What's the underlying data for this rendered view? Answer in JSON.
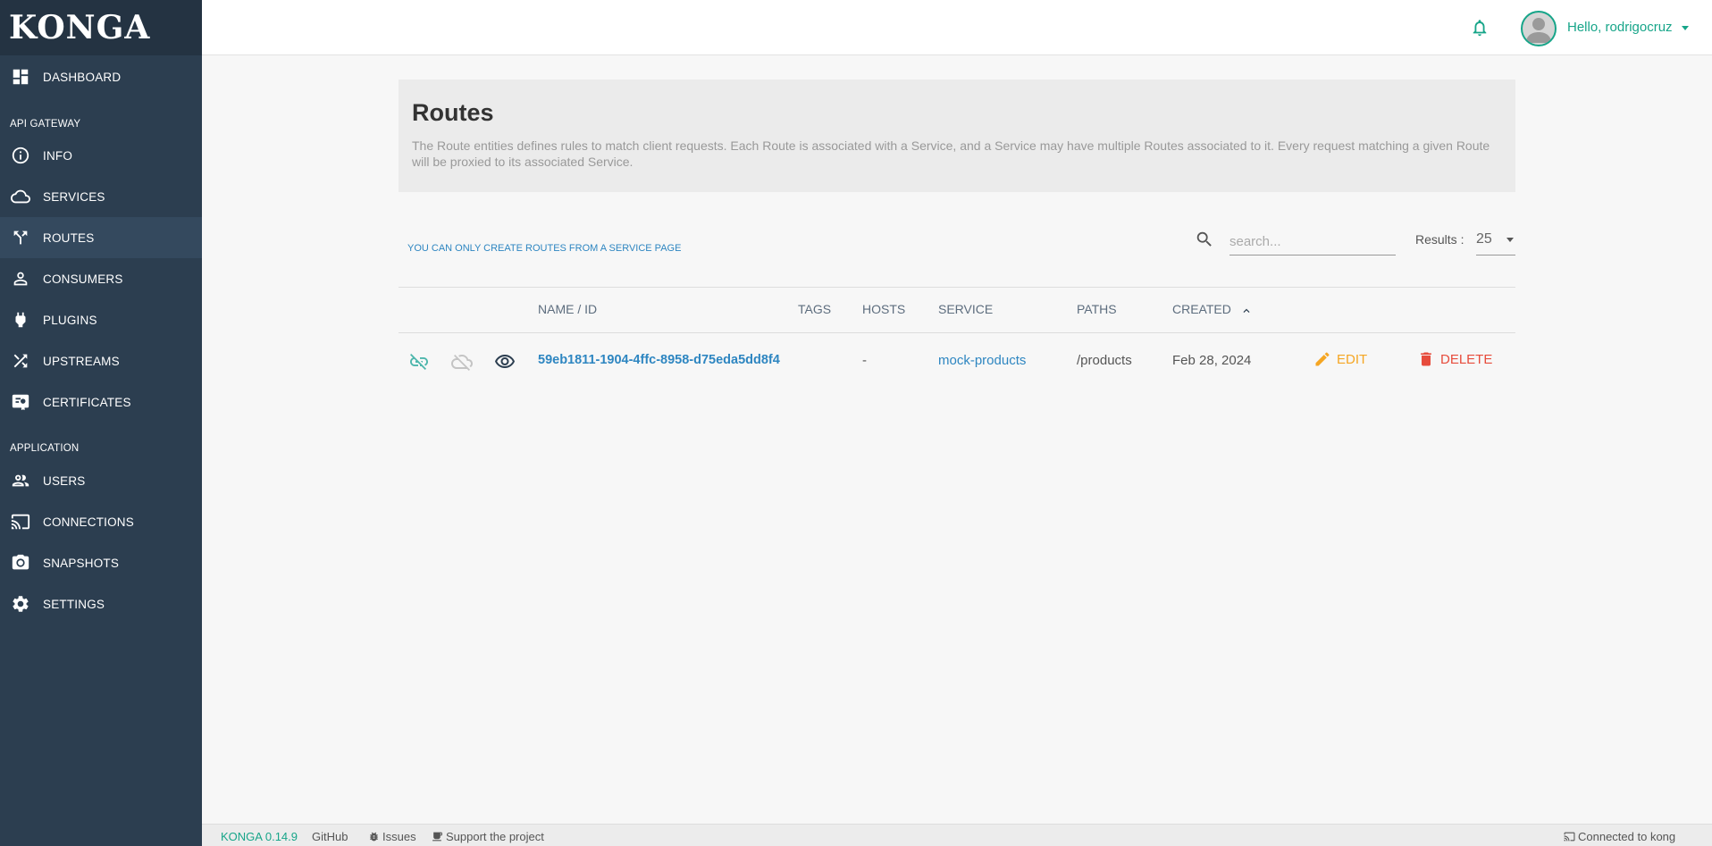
{
  "app": {
    "logo": "KONGA"
  },
  "sidebar": {
    "dashboard": "DASHBOARD",
    "section_api": "API GATEWAY",
    "info": "INFO",
    "services": "SERVICES",
    "routes": "ROUTES",
    "consumers": "CONSUMERS",
    "plugins": "PLUGINS",
    "upstreams": "UPSTREAMS",
    "certificates": "CERTIFICATES",
    "section_app": "APPLICATION",
    "users": "USERS",
    "connections": "CONNECTIONS",
    "snapshots": "SNAPSHOTS",
    "settings": "SETTINGS",
    "active_item": "routes"
  },
  "topbar": {
    "greeting": "Hello, rodrigocruz",
    "bell_icon": "bell-icon",
    "accent_color": "#17a589"
  },
  "header": {
    "title": "Routes",
    "description": "The Route entities defines rules to match client requests. Each Route is associated with a Service, and a Service may have multiple Routes associated to it. Every request matching a given Route will be proxied to its associated Service."
  },
  "toolbar": {
    "notice": "YOU CAN ONLY CREATE ROUTES FROM A SERVICE PAGE",
    "search_placeholder": "search...",
    "results_label": "Results :",
    "results_value": "25"
  },
  "table": {
    "columns": {
      "name": "NAME / ID",
      "tags": "TAGS",
      "hosts": "HOSTS",
      "service": "SERVICE",
      "paths": "PATHS",
      "created": "CREATED"
    },
    "rows": [
      {
        "id": "59eb1811-1904-4ffc-8958-d75eda5dd8f4",
        "tags": "",
        "hosts": "-",
        "service": "mock-products",
        "paths": "/products",
        "created": "Feb 28, 2024",
        "edit": "EDIT",
        "delete": "DELETE"
      }
    ]
  },
  "footer": {
    "version": "KONGA 0.14.9",
    "github": "GitHub",
    "issues": "Issues",
    "support": "Support the project",
    "connected": "Connected to kong"
  }
}
